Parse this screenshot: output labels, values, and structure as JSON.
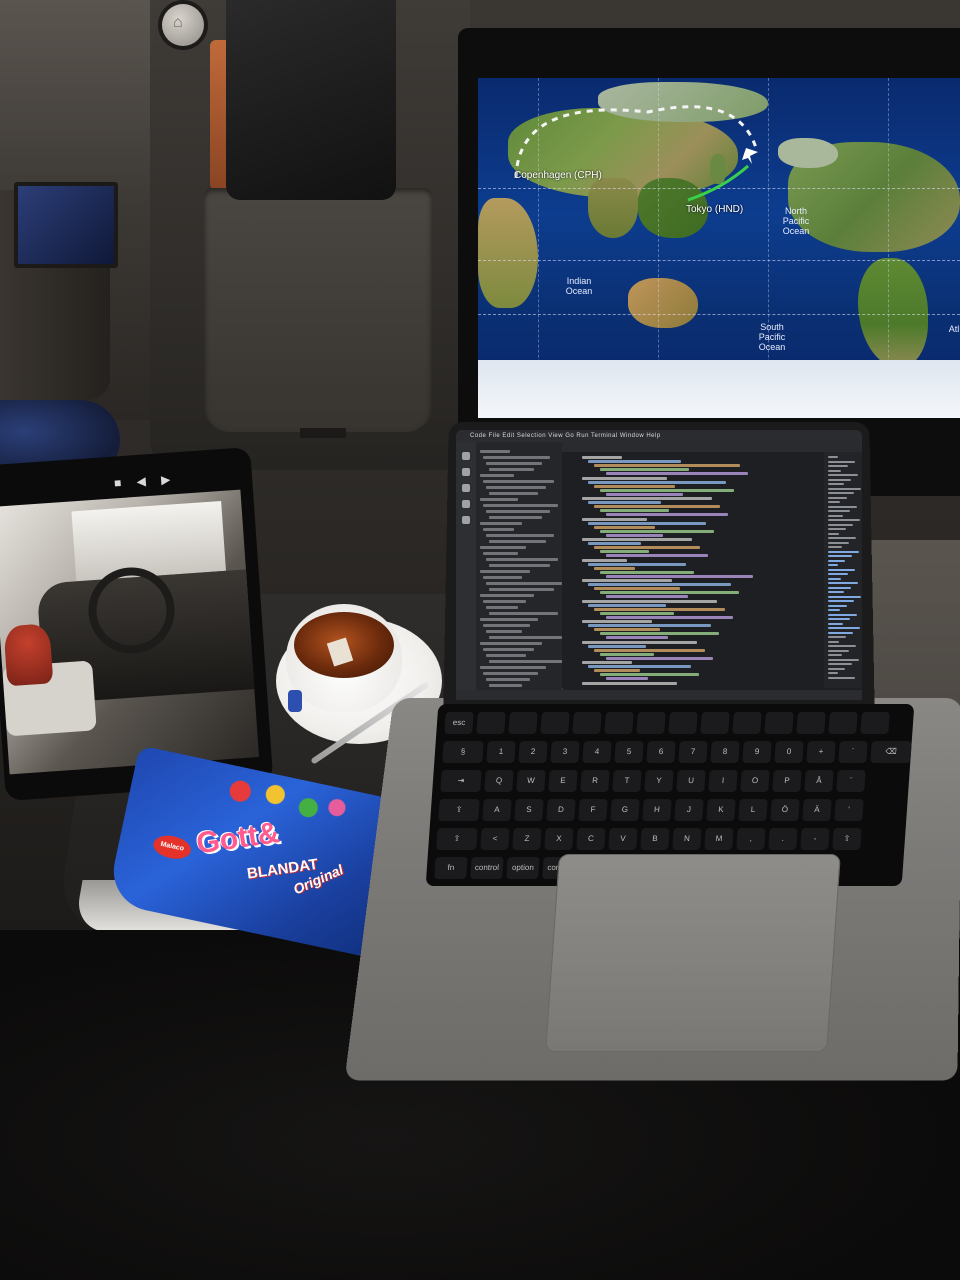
{
  "scene": {
    "description_colors": {
      "cabin": "#2c2926",
      "ife_ocean": "#0d3d8f",
      "laptop": "#7d7b78",
      "tea": "#8a3a12",
      "candy_bag": "#2a63d9"
    }
  },
  "ife_map": {
    "origin_label": "Copenhagen (CPH)",
    "destination_label": "Tokyo (HND)",
    "oceans": [
      {
        "id": "north-pacific",
        "label": "North\nPacific\nOcean"
      },
      {
        "id": "south-pacific",
        "label": "South\nPacific\nOcean"
      },
      {
        "id": "indian",
        "label": "Indian\nOcean"
      },
      {
        "id": "atlantic",
        "label": "Atl"
      }
    ]
  },
  "pocket": {
    "label": ""
  },
  "tablet": {
    "controls": "■ ◀ ▶"
  },
  "laptop": {
    "menubar_items": "Code  File  Edit  Selection  View  Go  Run  Terminal  Window  Help",
    "menubar_clock": "",
    "tab_title": "",
    "statusbar_text": "",
    "keyboard_rows": [
      [
        "esc",
        "",
        "",
        "",
        "",
        "",
        "",
        "",
        "",
        "",
        "",
        "",
        "",
        ""
      ],
      [
        "§",
        "1",
        "2",
        "3",
        "4",
        "5",
        "6",
        "7",
        "8",
        "9",
        "0",
        "+",
        "´",
        "⌫"
      ],
      [
        "⇥",
        "Q",
        "W",
        "E",
        "R",
        "T",
        "Y",
        "U",
        "I",
        "O",
        "P",
        "Å",
        "¨"
      ],
      [
        "⇪",
        "A",
        "S",
        "D",
        "F",
        "G",
        "H",
        "J",
        "K",
        "L",
        "Ö",
        "Ä",
        "'"
      ],
      [
        "⇧",
        "<",
        "Z",
        "X",
        "C",
        "V",
        "B",
        "N",
        "M",
        ",",
        ".",
        "-",
        "⇧"
      ],
      [
        "fn",
        "control",
        "option",
        "command",
        "",
        "command",
        "option"
      ]
    ]
  },
  "candy": {
    "brand": "Malaco",
    "title": "Gott&",
    "subtitle": "BLANDAT",
    "variant": "Original"
  }
}
